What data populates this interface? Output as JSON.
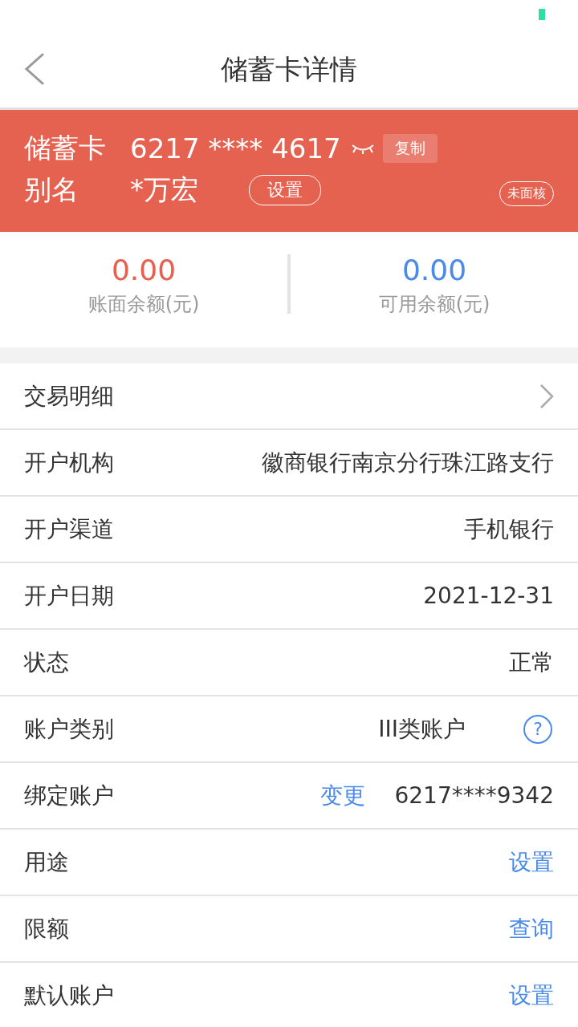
{
  "header": {
    "title": "储蓄卡详情"
  },
  "card": {
    "type_label": "储蓄卡",
    "number": "6217 **** 4617",
    "copy_button": "复制",
    "alias_label": "别名",
    "alias": "*万宏",
    "alias_button": "设置",
    "badge": "未面核"
  },
  "balances": [
    {
      "amount": "0.00",
      "label": "账面余额(元)",
      "color": "#e5604f"
    },
    {
      "amount": "0.00",
      "label": "可用余额(元)",
      "color": "#4a8ae8"
    }
  ],
  "rows": [
    {
      "kind": "link",
      "label": "交易明细"
    },
    {
      "kind": "value",
      "label": "开户机构",
      "value": "徽商银行南京分行珠江路支行"
    },
    {
      "kind": "value",
      "label": "开户渠道",
      "value": "手机银行"
    },
    {
      "kind": "value",
      "label": "开户日期",
      "value": "2021-12-31"
    },
    {
      "kind": "value",
      "label": "状态",
      "value": "正常"
    },
    {
      "kind": "help",
      "label": "账户类别",
      "value": "III类账户",
      "help": "?"
    },
    {
      "kind": "action_value",
      "label": "绑定账户",
      "action": "变更",
      "value": "6217****9342"
    },
    {
      "kind": "action",
      "label": "用途",
      "action": "设置"
    },
    {
      "kind": "action",
      "label": "限额",
      "action": "查询"
    },
    {
      "kind": "action",
      "label": "默认账户",
      "action": "设置"
    }
  ]
}
